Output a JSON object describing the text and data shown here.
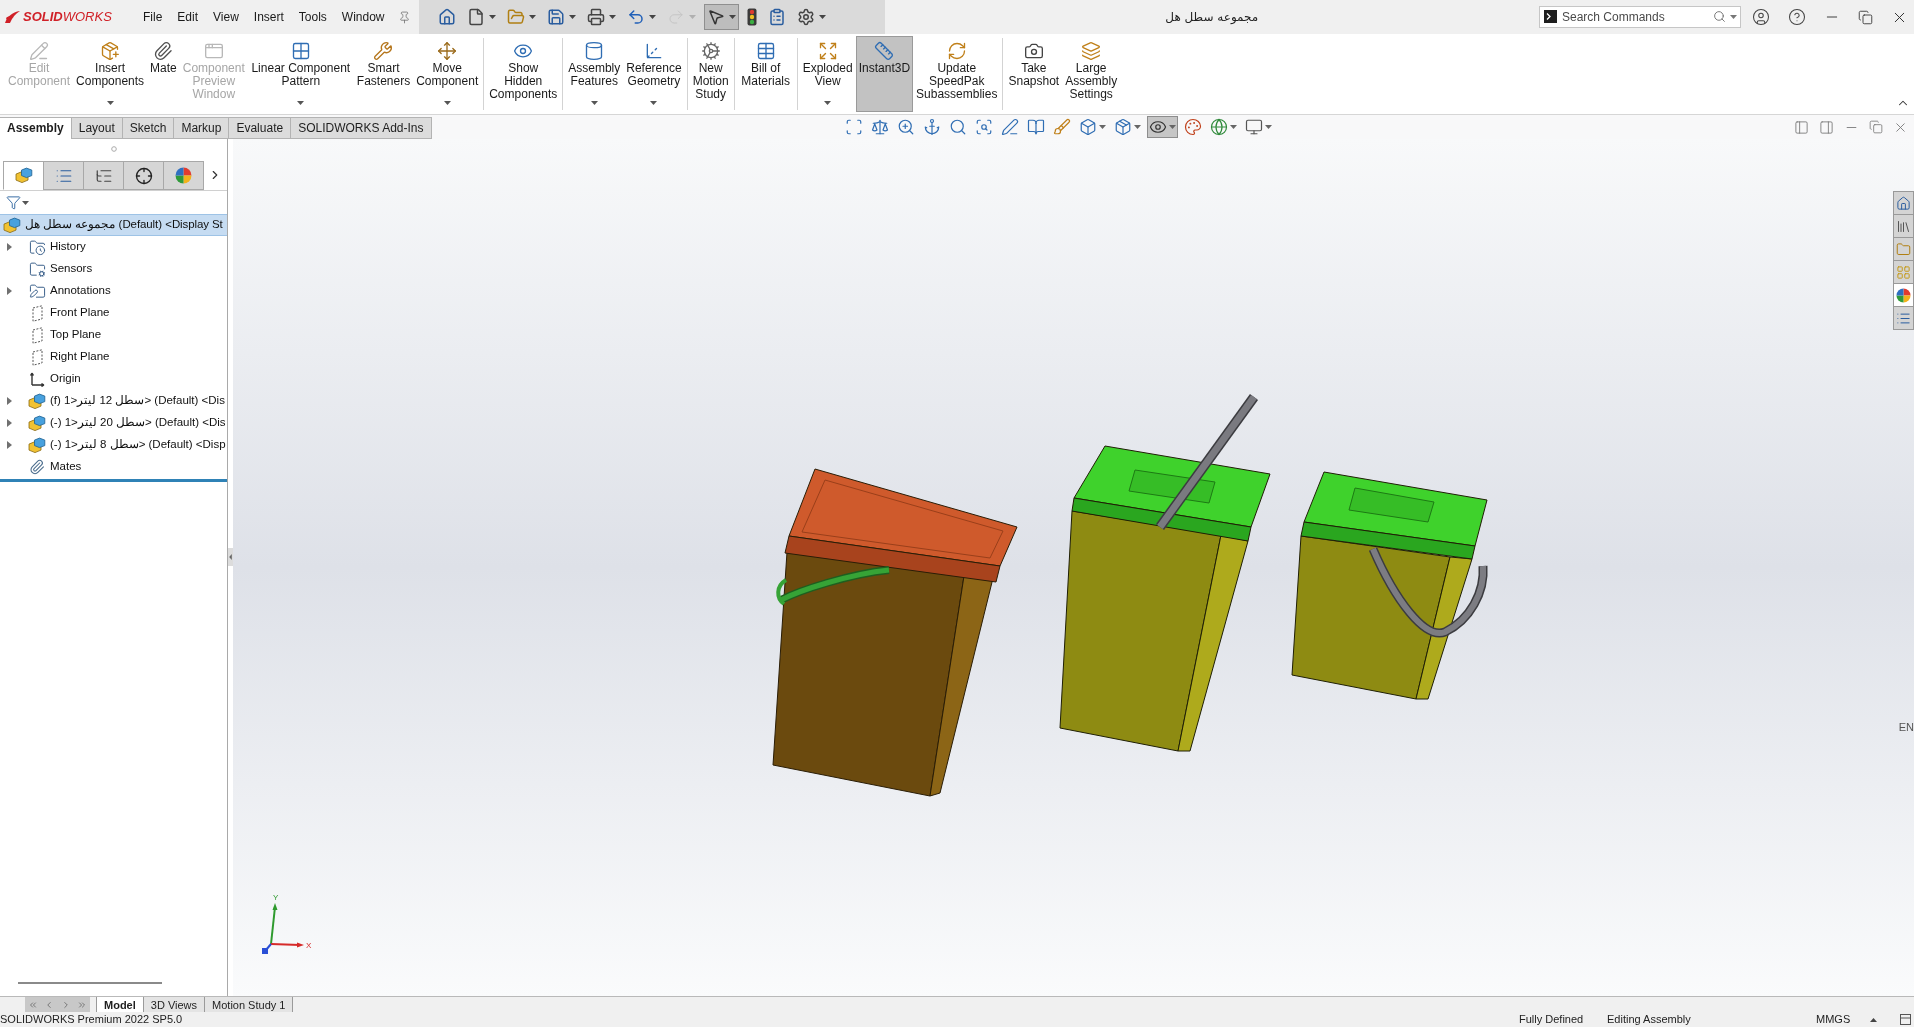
{
  "logo": {
    "text": "**SOLID**WORKS"
  },
  "menu": [
    "File",
    "Edit",
    "View",
    "Insert",
    "Tools",
    "Window"
  ],
  "quick_access": [
    {
      "kind": "home",
      "dropdown": false,
      "selected": false,
      "disabled": false
    },
    {
      "kind": "new",
      "dropdown": true,
      "selected": false,
      "disabled": false
    },
    {
      "kind": "open",
      "dropdown": true,
      "selected": false,
      "disabled": false
    },
    {
      "kind": "save",
      "dropdown": true,
      "selected": false,
      "disabled": false
    },
    {
      "kind": "print",
      "dropdown": true,
      "selected": false,
      "disabled": false
    },
    {
      "kind": "undo",
      "dropdown": true,
      "selected": false,
      "disabled": false
    },
    {
      "kind": "redo",
      "dropdown": true,
      "selected": false,
      "disabled": true
    },
    {
      "kind": "select",
      "dropdown": true,
      "selected": true,
      "disabled": false
    },
    {
      "kind": "rebuild",
      "dropdown": false,
      "selected": false,
      "disabled": false
    },
    {
      "kind": "properties",
      "dropdown": false,
      "selected": false,
      "disabled": false
    },
    {
      "kind": "options",
      "dropdown": true,
      "selected": false,
      "disabled": false
    }
  ],
  "window": {
    "title": "مجموعه سطل هل"
  },
  "search": {
    "placeholder": "Search Commands"
  },
  "ribbon": {
    "groups": [
      {
        "buttons": [
          {
            "kind": "edit",
            "label": "Edit Component",
            "dropdown": false,
            "disabled": true,
            "selected": false
          },
          {
            "kind": "insert",
            "label": "Insert Components",
            "dropdown": true,
            "disabled": false,
            "selected": false
          },
          {
            "kind": "mate",
            "label": "Mate",
            "dropdown": false,
            "disabled": false,
            "selected": false
          },
          {
            "kind": "preview",
            "label": "Component Preview Window",
            "dropdown": false,
            "disabled": true,
            "selected": false
          },
          {
            "kind": "pattern",
            "label": "Linear Component Pattern",
            "dropdown": true,
            "disabled": false,
            "selected": false
          },
          {
            "kind": "fasteners",
            "label": "Smart Fasteners",
            "dropdown": false,
            "disabled": false,
            "selected": false
          },
          {
            "kind": "move",
            "label": "Move Component",
            "dropdown": true,
            "disabled": false,
            "selected": false
          }
        ]
      },
      {
        "buttons": [
          {
            "kind": "show",
            "label": "Show Hidden Components",
            "dropdown": false,
            "disabled": false,
            "selected": false
          }
        ]
      },
      {
        "buttons": [
          {
            "kind": "features",
            "label": "Assembly Features",
            "dropdown": true,
            "disabled": false,
            "selected": false
          },
          {
            "kind": "reference",
            "label": "Reference Geometry",
            "dropdown": true,
            "disabled": false,
            "selected": false
          }
        ]
      },
      {
        "buttons": [
          {
            "kind": "motion",
            "label": "New Motion Study",
            "dropdown": false,
            "disabled": false,
            "selected": false
          }
        ]
      },
      {
        "buttons": [
          {
            "kind": "bom",
            "label": "Bill of Materials",
            "dropdown": false,
            "disabled": false,
            "selected": false
          }
        ]
      },
      {
        "buttons": [
          {
            "kind": "explode",
            "label": "Exploded View",
            "dropdown": true,
            "disabled": false,
            "selected": false
          },
          {
            "kind": "instant3d",
            "label": "Instant3D",
            "dropdown": false,
            "disabled": false,
            "selected": true
          },
          {
            "kind": "speedpak",
            "label": "Update SpeedPak Subassemblies",
            "dropdown": false,
            "disabled": false,
            "selected": false
          }
        ]
      },
      {
        "buttons": [
          {
            "kind": "snapshot",
            "label": "Take Snapshot",
            "dropdown": false,
            "disabled": false,
            "selected": false
          },
          {
            "kind": "settings",
            "label": "Large Assembly Settings",
            "dropdown": false,
            "disabled": false,
            "selected": false
          }
        ]
      }
    ]
  },
  "command_tabs": [
    {
      "label": "Assembly",
      "selected": true
    },
    {
      "label": "Layout",
      "selected": false
    },
    {
      "label": "Sketch",
      "selected": false
    },
    {
      "label": "Markup",
      "selected": false
    },
    {
      "label": "Evaluate",
      "selected": false
    },
    {
      "label": "SOLIDWORKS Add-Ins",
      "selected": false
    }
  ],
  "view_toolbar": [
    {
      "kind": "fit",
      "dropdown": false,
      "selected": false
    },
    {
      "kind": "balance",
      "dropdown": false,
      "selected": false
    },
    {
      "kind": "zoom",
      "dropdown": false,
      "selected": false
    },
    {
      "kind": "anchor",
      "dropdown": false,
      "selected": false
    },
    {
      "kind": "magnify",
      "dropdown": false,
      "selected": false
    },
    {
      "kind": "scan",
      "dropdown": false,
      "selected": false
    },
    {
      "kind": "pen",
      "dropdown": false,
      "selected": false
    },
    {
      "kind": "book",
      "dropdown": false,
      "selected": false
    },
    {
      "kind": "brush",
      "dropdown": false,
      "selected": false
    },
    {
      "kind": "orientation",
      "dropdown": true,
      "selected": false
    },
    {
      "kind": "style",
      "dropdown": true,
      "selected": false
    },
    {
      "kind": "visibility",
      "dropdown": true,
      "selected": true
    },
    {
      "kind": "appearance",
      "dropdown": false,
      "selected": false
    },
    {
      "kind": "scene",
      "dropdown": true,
      "selected": false
    },
    {
      "kind": "display",
      "dropdown": true,
      "selected": false
    }
  ],
  "feature_manager": {
    "tabs": [
      {
        "kind": "feature",
        "selected": true
      },
      {
        "kind": "property",
        "selected": false
      },
      {
        "kind": "configuration",
        "selected": false
      },
      {
        "kind": "dimxpert",
        "selected": false
      },
      {
        "kind": "display",
        "selected": false
      }
    ],
    "tree": {
      "label": "مجموعه سطل هل (Default) <Display St",
      "kind": "assembly",
      "selected": true,
      "children": [
        {
          "label": "History",
          "kind": "history",
          "expandable": true,
          "selected": false
        },
        {
          "label": "Sensors",
          "kind": "sensors",
          "expandable": false,
          "selected": false
        },
        {
          "label": "Annotations",
          "kind": "annotations",
          "expandable": true,
          "selected": false
        },
        {
          "label": "Front Plane",
          "kind": "plane",
          "expandable": false,
          "selected": false
        },
        {
          "label": "Top Plane",
          "kind": "plane",
          "expandable": false,
          "selected": false
        },
        {
          "label": "Right Plane",
          "kind": "plane",
          "expandable": false,
          "selected": false
        },
        {
          "label": "Origin",
          "kind": "origin",
          "expandable": false,
          "selected": false
        },
        {
          "label": "(f) سطل 12 لیتر<1> (Default) <Dis",
          "kind": "part",
          "expandable": true,
          "selected": false
        },
        {
          "label": "(-) سطل 20 لیتر<1> (Default) <Dis",
          "kind": "part",
          "expandable": true,
          "selected": false
        },
        {
          "label": "(-) سطل 8 لیتر<1> (Default) <Disp",
          "kind": "part",
          "expandable": true,
          "selected": false
        },
        {
          "label": "Mates",
          "kind": "mates",
          "expandable": false,
          "selected": false
        }
      ]
    }
  },
  "viewport": {
    "triad": {
      "y_label": "Y",
      "x_label": "X"
    },
    "side_label": "EN"
  },
  "task_pane": [
    {
      "kind": "home",
      "selected": false
    },
    {
      "kind": "library",
      "selected": false
    },
    {
      "kind": "folder",
      "selected": false
    },
    {
      "kind": "palette",
      "selected": false
    },
    {
      "kind": "appearance",
      "selected": true
    },
    {
      "kind": "properties",
      "selected": false
    }
  ],
  "bottom_tabs": [
    {
      "label": "Model",
      "selected": true
    },
    {
      "label": "3D Views",
      "selected": false
    },
    {
      "label": "Motion Study 1",
      "selected": false
    }
  ],
  "status_bar": {
    "product": "SOLIDWORKS Premium 2022 SP5.0",
    "state": "Fully Defined",
    "mode": "Editing Assembly",
    "units": "MMGS"
  }
}
